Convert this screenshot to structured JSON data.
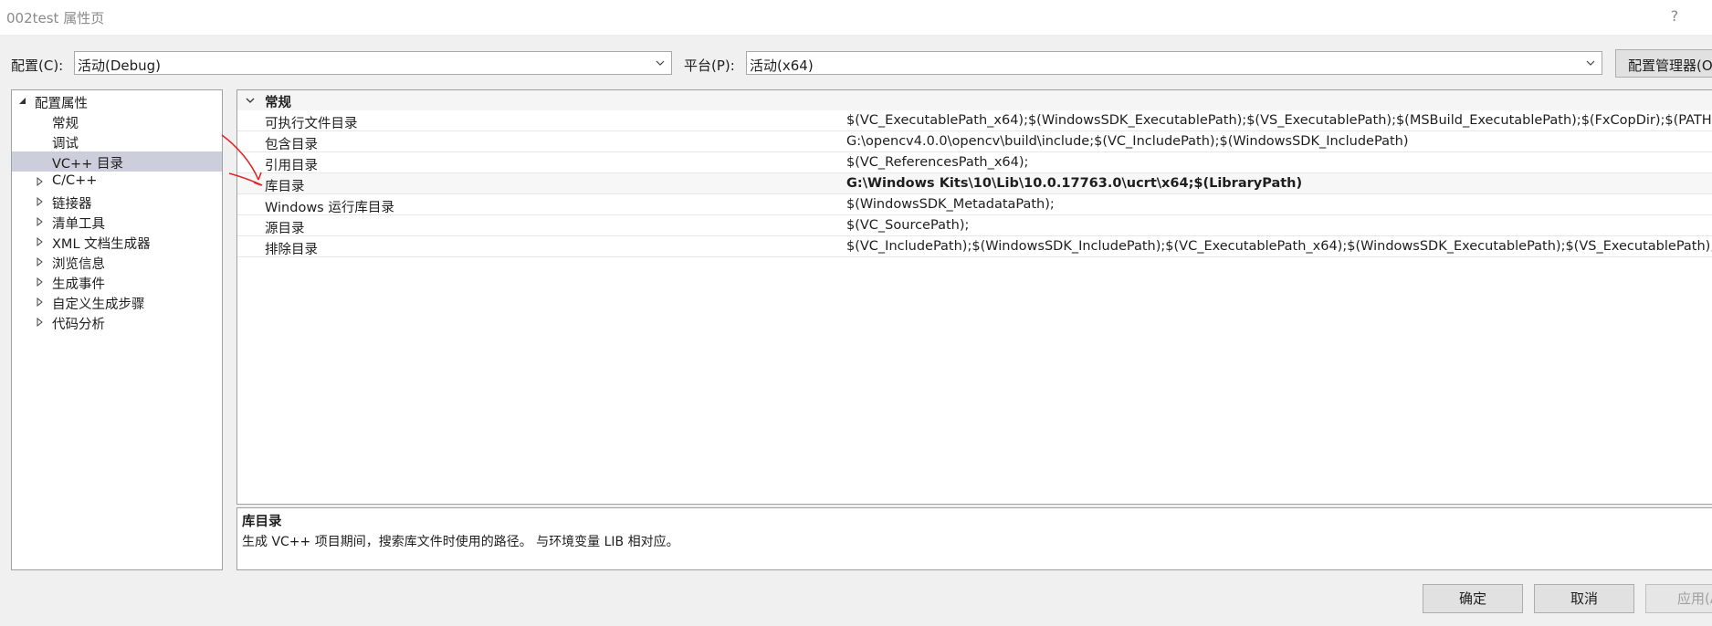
{
  "window": {
    "title": "002test 属性页",
    "help": "?"
  },
  "config_bar": {
    "config_label": "配置(C):",
    "config_value": "活动(Debug)",
    "platform_label": "平台(P):",
    "platform_value": "活动(x64)",
    "manager_button": "配置管理器(O"
  },
  "tree": {
    "root": "配置属性",
    "items": [
      {
        "label": "常规"
      },
      {
        "label": "调试"
      },
      {
        "label": "VC++ 目录",
        "selected": true
      },
      {
        "label": "C/C++"
      },
      {
        "label": "链接器"
      },
      {
        "label": "清单工具"
      },
      {
        "label": "XML 文档生成器"
      },
      {
        "label": "浏览信息"
      },
      {
        "label": "生成事件"
      },
      {
        "label": "自定义生成步骤"
      },
      {
        "label": "代码分析"
      }
    ]
  },
  "grid": {
    "category": "常规",
    "rows": [
      {
        "name": "可执行文件目录",
        "value": "$(VC_ExecutablePath_x64);$(WindowsSDK_ExecutablePath);$(VS_ExecutablePath);$(MSBuild_ExecutablePath);$(FxCopDir);$(PATH);"
      },
      {
        "name": "包含目录",
        "value": "G:\\opencv4.0.0\\opencv\\build\\include;$(VC_IncludePath);$(WindowsSDK_IncludePath)"
      },
      {
        "name": "引用目录",
        "value": "$(VC_ReferencesPath_x64);"
      },
      {
        "name": "库目录",
        "value": "G:\\Windows Kits\\10\\Lib\\10.0.17763.0\\ucrt\\x64;$(LibraryPath)"
      },
      {
        "name": "Windows 运行库目录",
        "value": "$(WindowsSDK_MetadataPath);"
      },
      {
        "name": "源目录",
        "value": "$(VC_SourcePath);"
      },
      {
        "name": "排除目录",
        "value": "$(VC_IncludePath);$(WindowsSDK_IncludePath);$(VC_ExecutablePath_x64);$(WindowsSDK_ExecutablePath);$(VS_ExecutablePath);$"
      }
    ]
  },
  "description": {
    "title": "库目录",
    "text": "生成 VC++ 项目期间，搜索库文件时使用的路径。 与环境变量 LIB 相对应。"
  },
  "buttons": {
    "ok": "确定",
    "cancel": "取消",
    "apply": "应用(A"
  },
  "colors": {
    "selection": "#cccedb",
    "annotation_arrow": "#e0262a"
  },
  "icons": [
    "help-icon",
    "dropdown-arrow-icon",
    "expand-triangle-icon",
    "collapse-triangle-icon",
    "annotation-arrow"
  ]
}
